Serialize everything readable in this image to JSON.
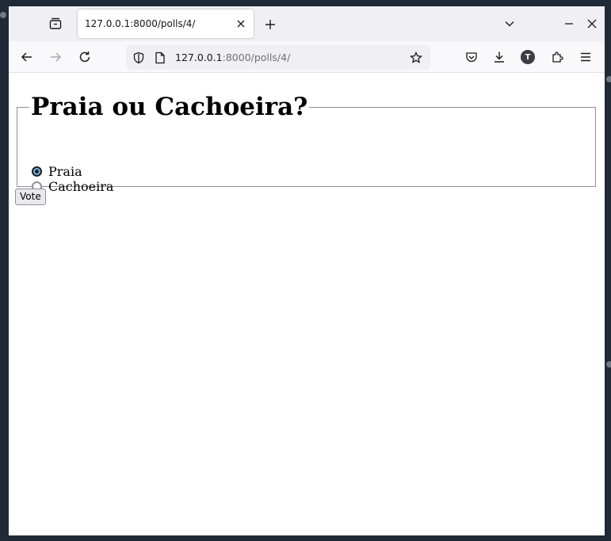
{
  "browser": {
    "tab": {
      "title": "127.0.0.1:8000/polls/4/"
    },
    "urlbar": {
      "host": "127.0.0.1",
      "path": ":8000/polls/4/"
    },
    "account_initial": "T",
    "icons": {
      "tab_overview": "tab-overview-icon",
      "new_tab": "plus-icon",
      "list_all_tabs": "chevron-down-icon",
      "minimize": "minimize-icon",
      "close_window": "close-icon",
      "back": "back-arrow-icon",
      "forward": "forward-arrow-icon",
      "reload": "reload-icon",
      "shield": "shield-icon",
      "page": "page-icon",
      "bookmark": "star-icon",
      "pocket": "pocket-icon",
      "downloads": "download-icon",
      "extensions": "puzzle-icon",
      "menu": "hamburger-menu-icon"
    }
  },
  "poll": {
    "question": "Praia ou Cachoeira?",
    "choices": [
      {
        "label": "Praia",
        "checked": true
      },
      {
        "label": "Cachoeira",
        "checked": false
      }
    ],
    "submit_label": "Vote"
  }
}
